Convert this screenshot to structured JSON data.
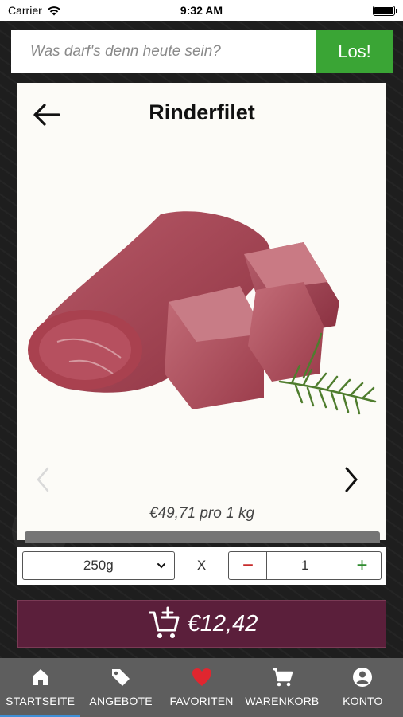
{
  "status_bar": {
    "carrier": "Carrier",
    "time": "9:32 AM"
  },
  "search": {
    "placeholder": "Was darf's denn heute sein?",
    "button_label": "Los!"
  },
  "product": {
    "title": "Rinderfilet",
    "price_per_unit": "€49,71 pro 1 kg",
    "image_icon": "beef-fillet-image"
  },
  "order": {
    "weight_selected": "250g",
    "multiplier": "X",
    "quantity": "1",
    "minus_label": "−",
    "plus_label": "+",
    "total": "€12,42"
  },
  "tabs": [
    {
      "label": "STARTSEITE",
      "icon": "home-icon"
    },
    {
      "label": "ANGEBOTE",
      "icon": "tag-icon"
    },
    {
      "label": "FAVORITEN",
      "icon": "heart-icon"
    },
    {
      "label": "WARENKORB",
      "icon": "cart-icon"
    },
    {
      "label": "KONTO",
      "icon": "account-icon"
    }
  ],
  "colors": {
    "accent_green": "#3aa535",
    "cart_button": "#5b1f3b",
    "favorite_red": "#e0262f",
    "tabbar": "#5e5e5e"
  }
}
